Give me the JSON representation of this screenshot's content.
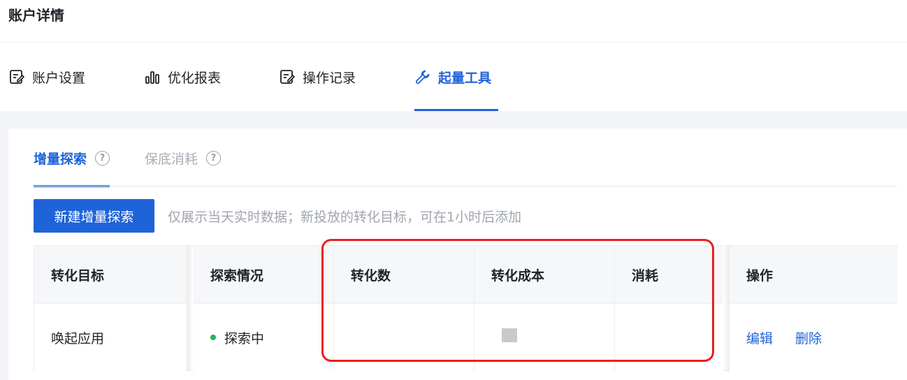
{
  "page": {
    "title": "账户详情"
  },
  "main_tabs": [
    {
      "label": "账户设置",
      "icon": "edit-icon",
      "active": false
    },
    {
      "label": "优化报表",
      "icon": "bar-chart-icon",
      "active": false
    },
    {
      "label": "操作记录",
      "icon": "edit-icon",
      "active": false
    },
    {
      "label": "起量工具",
      "icon": "wrench-icon",
      "active": true
    }
  ],
  "sub_tabs": [
    {
      "label": "增量探索",
      "icon": "help-circle-icon",
      "active": true
    },
    {
      "label": "保底消耗",
      "icon": "help-circle-icon",
      "active": false
    }
  ],
  "toolbar": {
    "new_button": "新建增量探索",
    "hint": "仅展示当天实时数据；新投放的转化目标，可在1小时后添加"
  },
  "table": {
    "columns": [
      "转化目标",
      "探索情况",
      "转化数",
      "转化成本",
      "消耗",
      "操作"
    ],
    "rows": [
      {
        "target": "唤起应用",
        "status": "探索中",
        "status_color": "#22b45c",
        "conversions": "",
        "cost": "",
        "spend": "",
        "actions": [
          "编辑",
          "删除"
        ]
      }
    ]
  },
  "colors": {
    "accent": "#1f63d8",
    "highlight": "#f01e1e",
    "status_active": "#22b45c"
  }
}
